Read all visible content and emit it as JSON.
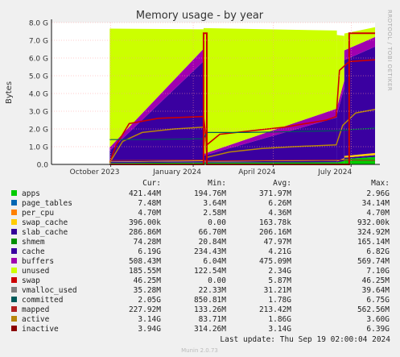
{
  "chart_data": {
    "type": "area",
    "title": "Memory usage - by year",
    "ylabel": "Bytes",
    "side_label": "RRDTOOL / TOBI OETIKER",
    "y_ticks": [
      "0.0",
      "1.0 G",
      "2.0 G",
      "3.0 G",
      "4.0 G",
      "5.0 G",
      "6.0 G",
      "7.0 G",
      "8.0 G"
    ],
    "ylim": [
      0,
      8.0
    ],
    "x_ticks": [
      {
        "label": "October 2023",
        "t": 0.183
      },
      {
        "label": "January 2024",
        "t": 0.438
      },
      {
        "label": "April 2024",
        "t": 0.685
      },
      {
        "label": "July 2024",
        "t": 0.926
      }
    ],
    "x_range": [
      "2023-09",
      "2024-09-19"
    ],
    "grid": true,
    "columns": [
      "Cur:",
      "Min:",
      "Avg:",
      "Max:"
    ],
    "series": [
      {
        "name": "apps",
        "color": "#00cc00",
        "cur": "421.44M",
        "min": "194.76M",
        "avg": "371.97M",
        "max": "2.96G"
      },
      {
        "name": "page_tables",
        "color": "#0066b3",
        "cur": "7.48M",
        "min": "3.64M",
        "avg": "6.26M",
        "max": "34.14M"
      },
      {
        "name": "per_cpu",
        "color": "#ff8000",
        "cur": "4.70M",
        "min": "2.58M",
        "avg": "4.36M",
        "max": "4.70M"
      },
      {
        "name": "swap_cache",
        "color": "#ffcc00",
        "cur": "396.00k",
        "min": "0.00",
        "avg": "163.78k",
        "max": "932.00k"
      },
      {
        "name": "slab_cache",
        "color": "#330099",
        "cur": "286.86M",
        "min": "66.70M",
        "avg": "206.16M",
        "max": "324.92M"
      },
      {
        "name": "shmem",
        "color": "#008f00",
        "cur": "74.28M",
        "min": "20.84M",
        "avg": "47.97M",
        "max": "165.14M"
      },
      {
        "name": "cache",
        "color": "#3a00a0",
        "cur": "6.19G",
        "min": "234.43M",
        "avg": "4.21G",
        "max": "6.82G"
      },
      {
        "name": "buffers",
        "color": "#a000b0",
        "cur": "508.43M",
        "min": "6.04M",
        "avg": "475.09M",
        "max": "569.74M"
      },
      {
        "name": "unused",
        "color": "#ccff00",
        "cur": "185.55M",
        "min": "122.54M",
        "avg": "2.34G",
        "max": "7.10G"
      },
      {
        "name": "swap",
        "color": "#cc0000",
        "cur": "46.25M",
        "min": "0.00",
        "avg": "5.87M",
        "max": "46.25M"
      },
      {
        "name": "vmalloc_used",
        "color": "#808080",
        "cur": "35.28M",
        "min": "22.33M",
        "avg": "31.21M",
        "max": "39.64M"
      },
      {
        "name": "committed",
        "color": "#005a5a",
        "cur": "2.05G",
        "min": "850.81M",
        "avg": "1.78G",
        "max": "6.75G"
      },
      {
        "name": "mapped",
        "color": "#b22222",
        "cur": "227.92M",
        "min": "133.26M",
        "avg": "213.42M",
        "max": "562.56M"
      },
      {
        "name": "active",
        "color": "#b8860b",
        "cur": "3.14G",
        "min": "83.71M",
        "avg": "1.86G",
        "max": "3.60G"
      },
      {
        "name": "inactive",
        "color": "#8b0000",
        "cur": "3.94G",
        "min": "314.26M",
        "avg": "3.14G",
        "max": "6.39G"
      }
    ],
    "last_update": "Last update: Thu Sep 19 02:00:04 2024",
    "footer": "Munin 2.0.73"
  }
}
